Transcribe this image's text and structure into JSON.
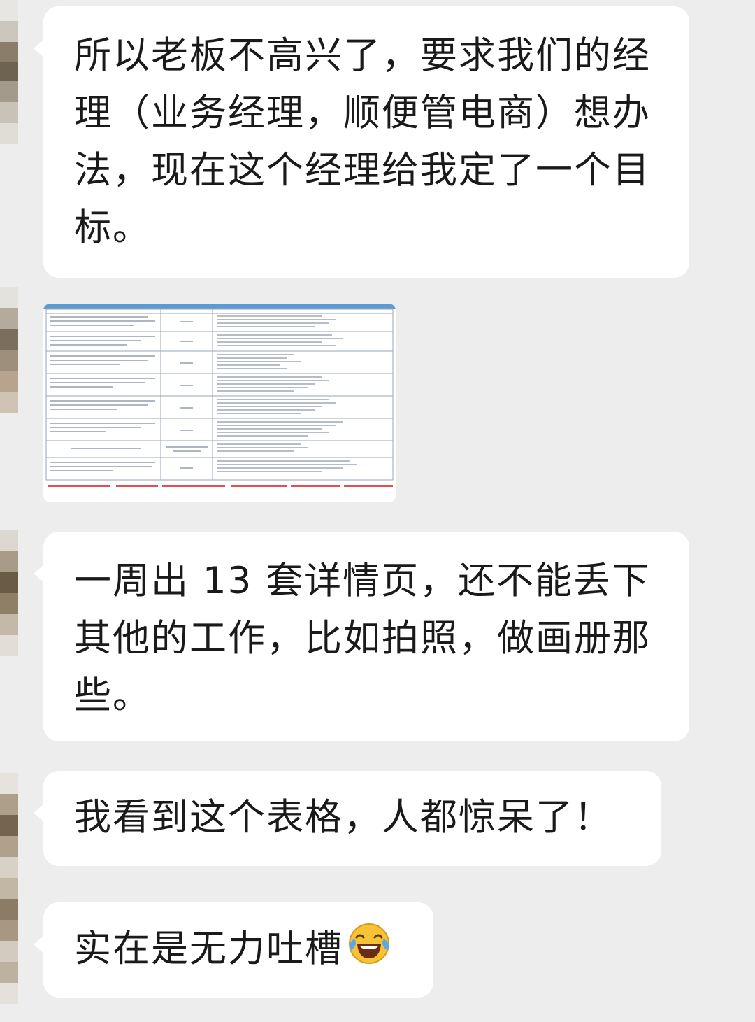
{
  "chat": {
    "messages": [
      {
        "type": "text",
        "text": "所以老板不高兴了，要求我们的经理（业务经理，顺便管电商）想办法，现在这个经理给我定了一个目标。"
      },
      {
        "type": "image",
        "description_label": "table-screenshot"
      },
      {
        "type": "text",
        "text": "一周出 13 套详情页，还不能丢下其他的工作，比如拍照，做画册那些。"
      },
      {
        "type": "text",
        "text": "我看到这个表格，人都惊呆了！"
      },
      {
        "type": "text",
        "text": "实在是无力吐槽",
        "emoji": "laughing-with-tears-emoji"
      }
    ]
  },
  "colors": {
    "background": "#ededed",
    "bubble": "#ffffff",
    "text": "#1a1a1a",
    "table_header": "#5b9bd5",
    "table_note_red": "#e05050"
  }
}
